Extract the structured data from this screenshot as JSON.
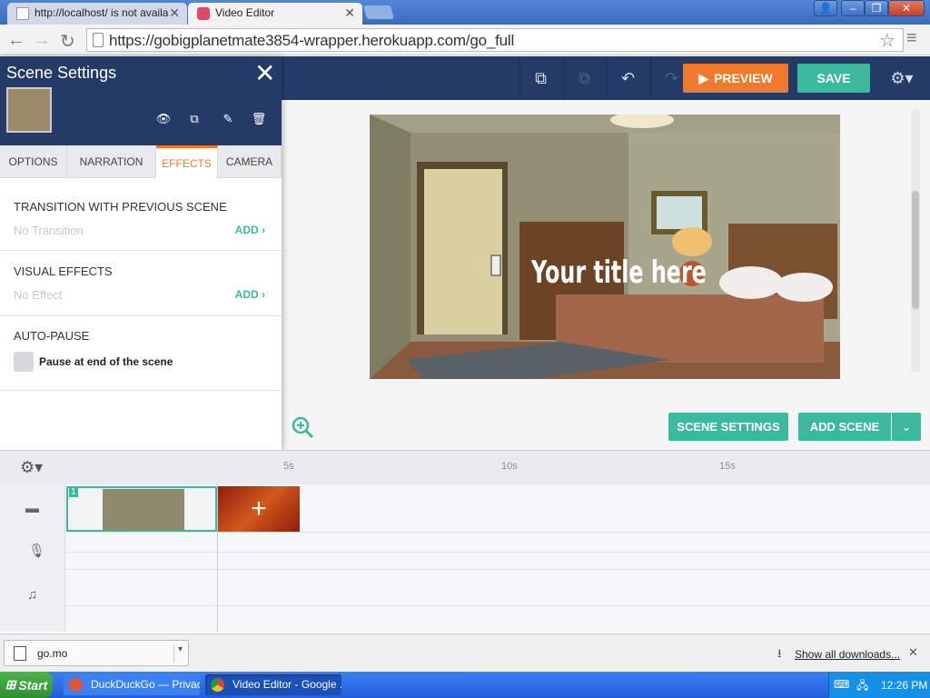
{
  "browser": {
    "tabs": [
      {
        "title": "http://localhost/ is not availa"
      },
      {
        "title": "Video Editor"
      }
    ],
    "url": "https://gobigplanetmate3854-wrapper.herokuapp.com/go_full"
  },
  "toolbar": {
    "preview_label": "PREVIEW",
    "save_label": "SAVE"
  },
  "scene_panel": {
    "title": "Scene Settings",
    "tabs": [
      "OPTIONS",
      "NARRATION",
      "EFFECTS",
      "CAMERA"
    ],
    "active_tab": "EFFECTS",
    "transition": {
      "label": "TRANSITION WITH PREVIOUS SCENE",
      "value": "No Transition",
      "add": "ADD"
    },
    "visual_effects": {
      "label": "VISUAL EFFECTS",
      "value": "No Effect",
      "add": "ADD"
    },
    "auto_pause": {
      "label": "AUTO-PAUSE",
      "checkbox_label": "Pause at end of the scene",
      "checked": false
    }
  },
  "stage": {
    "title_text": "Your title here"
  },
  "actions": {
    "scene_settings": "SCENE SETTINGS",
    "add_scene": "ADD SCENE"
  },
  "timeline": {
    "ticks": [
      "5s",
      "10s",
      "15s"
    ],
    "scene_number": "1"
  },
  "downloads": {
    "file": "go.mo",
    "show_all": "Show all downloads..."
  },
  "taskbar": {
    "start": "Start",
    "tasks": [
      "DuckDuckGo — Privac...",
      "Video Editor - Google ..."
    ],
    "time": "12:26 PM"
  }
}
